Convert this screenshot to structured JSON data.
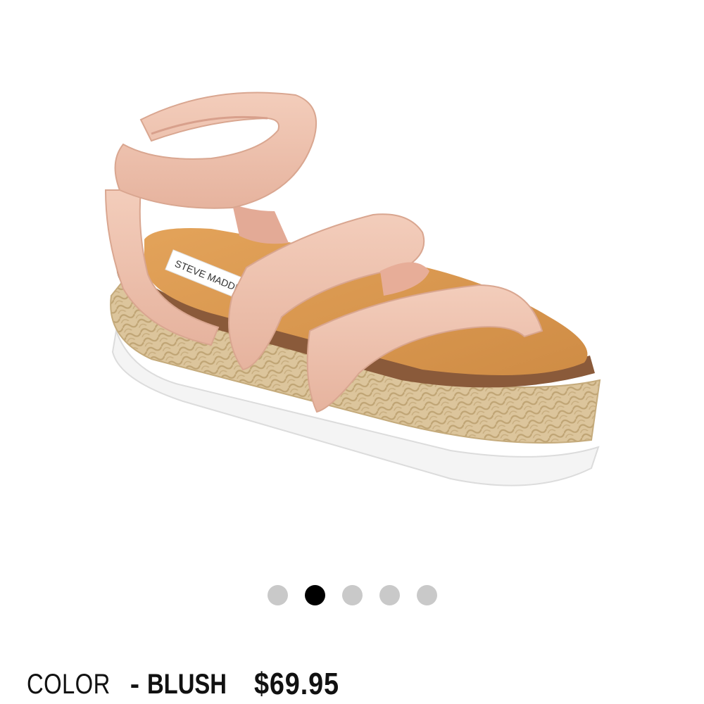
{
  "product": {
    "image_alt": "Blush espadrille platform sandal",
    "brand_insole_text": "STEVE MADDEN",
    "color_label": "COLOR",
    "color_separator": "-",
    "color_value": "BLUSH",
    "price": "$69.95"
  },
  "carousel": {
    "total": 5,
    "active_index": 1
  },
  "colors": {
    "strap": "#eec3b0",
    "insole": "#d99a52",
    "cork": "#8a5a3a",
    "jute": "#d9c39a",
    "sole": "#f5f5f5",
    "dot_inactive": "#c9c9c9",
    "dot_active": "#000000"
  }
}
